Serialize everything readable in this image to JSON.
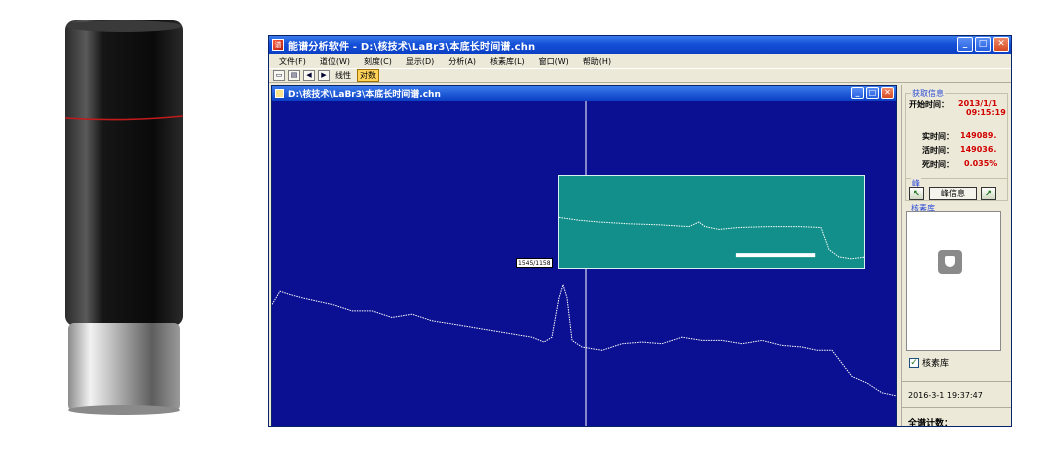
{
  "window": {
    "title": "能谱分析软件 - D:\\核技术\\LaBr3\\本底长时间谱.chn",
    "minimize": "_",
    "maximize": "□",
    "close": "✕"
  },
  "menu": [
    "文件(F)",
    "道位(W)",
    "刻度(C)",
    "显示(D)",
    "分析(A)",
    "核素库(L)",
    "窗口(W)",
    "帮助(H)"
  ],
  "toolbar": {
    "linear_label": "线性",
    "log_label": "对数",
    "active": "对数"
  },
  "child": {
    "title": "D:\\核技术\\LaBr3\\本底长时间谱.chn",
    "cursor_readout": "1545/1158"
  },
  "side": {
    "acquire": {
      "title": "获取信息",
      "start_label": "开始时间：",
      "start_date": "2013/1/1",
      "start_time": "09:15:19",
      "real_label": "实时间：",
      "real_value": "149089.",
      "live_label": "活时间：",
      "live_value": "149036.",
      "dead_label": "死时间：",
      "dead_value": "0.035%"
    },
    "peak": {
      "title": "峰",
      "info_button": "峰信息"
    },
    "library": {
      "title": "核素库",
      "checkbox_label": "核素库",
      "checked": true
    },
    "timestamp": "2016-3-1 19:37:47",
    "total_label": "全谱计数："
  },
  "colors": {
    "plot_bg": "#0a1091",
    "inset_bg": "#128f8a",
    "trace": "#ffffff",
    "value_red": "#d20000"
  },
  "spectrum": {
    "main_trace": [
      [
        0,
        0.62
      ],
      [
        8,
        0.58
      ],
      [
        18,
        0.59
      ],
      [
        30,
        0.6
      ],
      [
        45,
        0.61
      ],
      [
        60,
        0.62
      ],
      [
        80,
        0.64
      ],
      [
        100,
        0.64
      ],
      [
        120,
        0.66
      ],
      [
        140,
        0.65
      ],
      [
        160,
        0.67
      ],
      [
        180,
        0.68
      ],
      [
        200,
        0.69
      ],
      [
        220,
        0.7
      ],
      [
        240,
        0.71
      ],
      [
        260,
        0.72
      ],
      [
        272,
        0.735
      ],
      [
        280,
        0.72
      ],
      [
        287,
        0.6
      ],
      [
        291,
        0.56
      ],
      [
        295,
        0.6
      ],
      [
        300,
        0.73
      ],
      [
        310,
        0.75
      ],
      [
        330,
        0.76
      ],
      [
        350,
        0.74
      ],
      [
        370,
        0.735
      ],
      [
        390,
        0.74
      ],
      [
        410,
        0.72
      ],
      [
        430,
        0.73
      ],
      [
        450,
        0.73
      ],
      [
        470,
        0.74
      ],
      [
        490,
        0.73
      ],
      [
        510,
        0.745
      ],
      [
        530,
        0.75
      ],
      [
        545,
        0.76
      ],
      [
        560,
        0.76
      ],
      [
        570,
        0.8
      ],
      [
        580,
        0.84
      ],
      [
        595,
        0.86
      ],
      [
        610,
        0.89
      ],
      [
        626,
        0.9
      ]
    ],
    "inset_trace": [
      [
        0,
        0.45
      ],
      [
        20,
        0.48
      ],
      [
        40,
        0.5
      ],
      [
        70,
        0.52
      ],
      [
        100,
        0.53
      ],
      [
        130,
        0.55
      ],
      [
        140,
        0.5
      ],
      [
        146,
        0.55
      ],
      [
        160,
        0.58
      ],
      [
        180,
        0.56
      ],
      [
        210,
        0.55
      ],
      [
        240,
        0.55
      ],
      [
        262,
        0.56
      ],
      [
        270,
        0.8
      ],
      [
        280,
        0.88
      ],
      [
        292,
        0.9
      ],
      [
        307,
        0.88
      ]
    ],
    "inset_marker": [
      0.58,
      0.84,
      0.86
    ]
  }
}
